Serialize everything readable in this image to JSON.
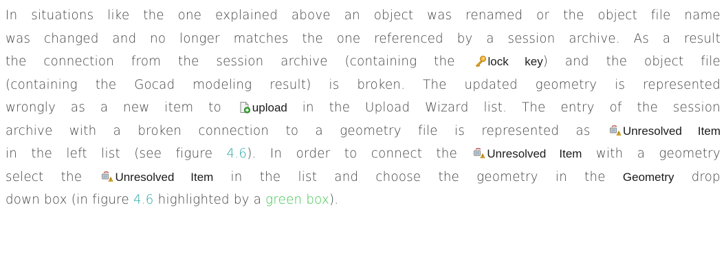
{
  "paragraph": {
    "l1": "In situations like the one explained above an object was renamed or the object file name",
    "l2": "was changed and no longer matches the one referenced by a session archive. As a result",
    "l3_a": "the connection from the session archive (containing the",
    "l3_term": "lock key",
    "l3_b": ") and the object file",
    "l4": "(containing the Gocad modeling result) is broken. The updated geometry is represented",
    "l5_a": "wrongly as a new item to",
    "l5_term": "upload",
    "l5_b": "in the Upload Wizard list.  The entry of the session",
    "l6_a": "archive with a broken connection to a geometry file is represented as",
    "l6_term": "Unresolved Item",
    "l7_a": "in the left list (see figure",
    "l7_ref": "4.6",
    "l7_b": "). In order to connect the",
    "l7_term": "Unresolved Item",
    "l7_c": "with a geometry",
    "l8_a": "select the",
    "l8_term": "Unresolved Item",
    "l8_b": "in the list and choose the geometry in the",
    "l8_term2": "Geometry",
    "l8_c": "drop",
    "l9_a": "down box (in figure",
    "l9_ref": "4.6",
    "l9_b": "highlighted by a",
    "l9_green": "green box",
    "l9_c": ")."
  },
  "icons": {
    "lock_key": "key-icon",
    "upload": "upload-document-icon",
    "unresolved": "unresolved-item-icon"
  },
  "colors": {
    "body_text": "#404040",
    "ui_term": "#1a1a1a",
    "figure_ref": "#2aa6a6",
    "highlight_green": "#39c44a"
  }
}
